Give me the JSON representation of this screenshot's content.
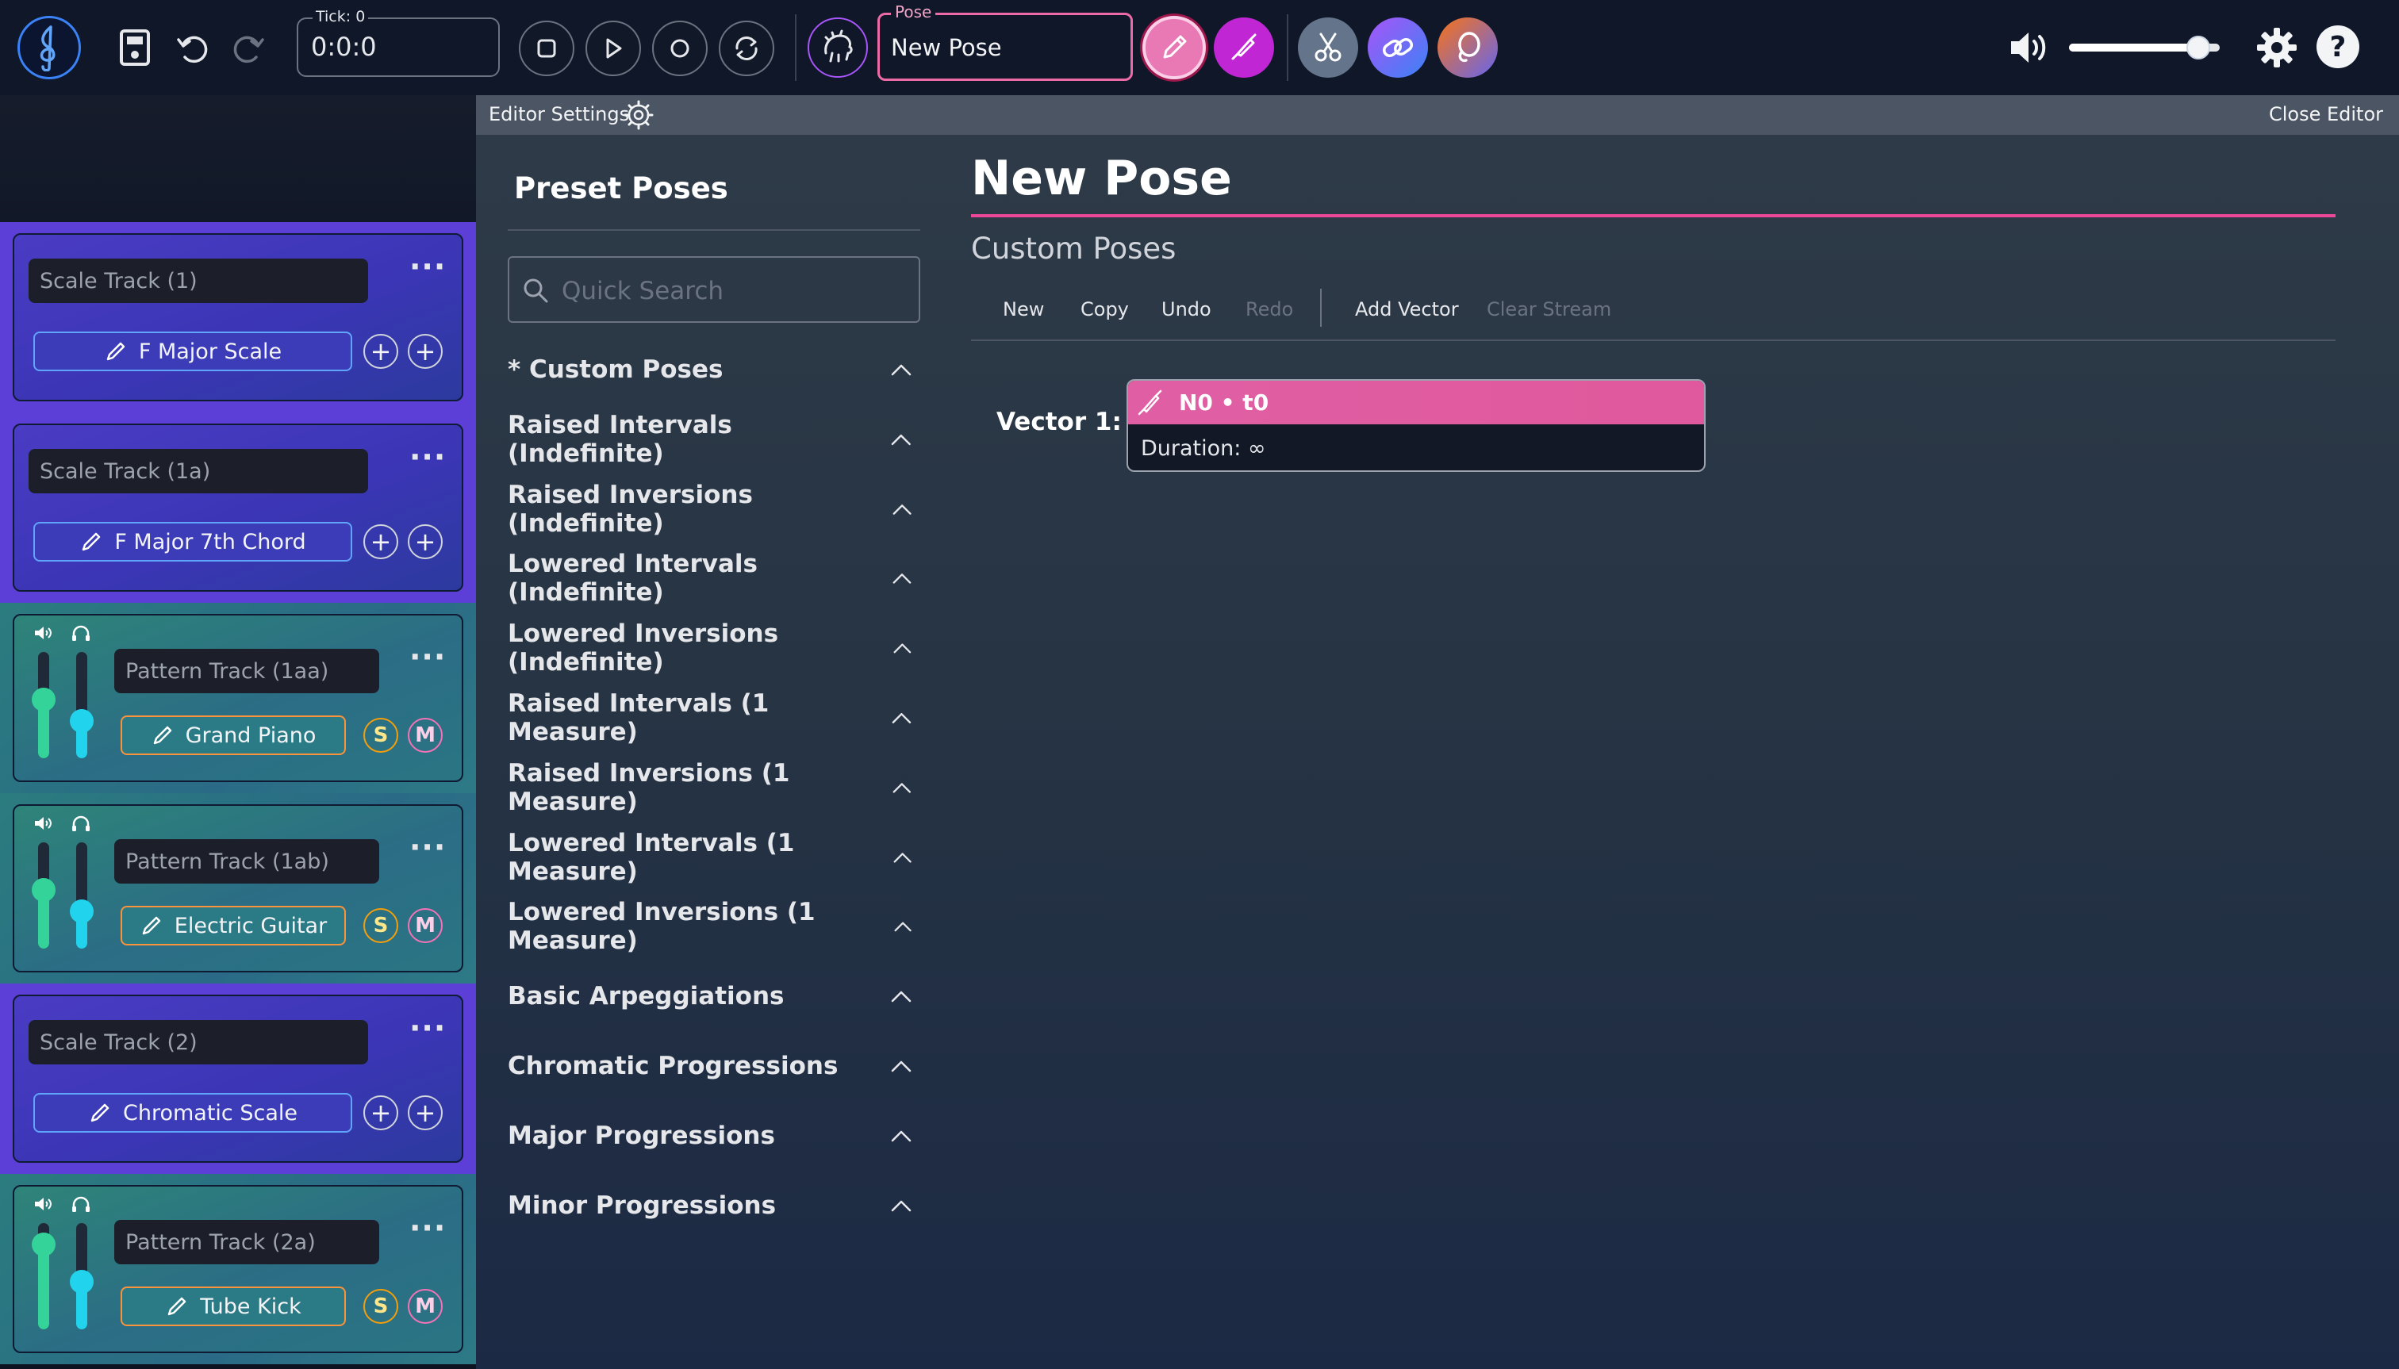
{
  "topbar": {
    "tick_label": "Tick: 0",
    "tick_value": "0:0:0",
    "pose_label": "Pose",
    "pose_value": "New Pose",
    "volume_level": 0.86
  },
  "editor_header": {
    "settings_label": "Editor Settings",
    "close_label": "Close Editor"
  },
  "presets": {
    "title": "Preset Poses",
    "search_placeholder": "Quick Search",
    "categories": [
      "* Custom Poses",
      "Raised Intervals (Indefinite)",
      "Raised Inversions (Indefinite)",
      "Lowered Intervals (Indefinite)",
      "Lowered Inversions (Indefinite)",
      "Raised Intervals (1 Measure)",
      "Raised Inversions (1 Measure)",
      "Lowered Intervals (1 Measure)",
      "Lowered Inversions (1 Measure)",
      "Basic Arpeggiations",
      "Chromatic Progressions",
      "Major Progressions",
      "Minor Progressions"
    ]
  },
  "pose_editor": {
    "title": "New Pose",
    "subtitle": "Custom Poses",
    "toolbar": {
      "new": "New",
      "copy": "Copy",
      "undo": "Undo",
      "redo": "Redo",
      "add_vector": "Add Vector",
      "clear_stream": "Clear Stream"
    },
    "vector": {
      "label": "Vector 1:",
      "name": "N0 • t0",
      "duration": "Duration: ∞"
    }
  },
  "tracks": [
    {
      "type": "scale",
      "name": "Scale Track (1)",
      "instrument": "F Major Scale"
    },
    {
      "type": "scale",
      "name": "Scale Track (1a)",
      "instrument": "F Major 7th Chord"
    },
    {
      "type": "pattern",
      "name": "Pattern Track (1aa)",
      "instrument": "Grand Piano",
      "solo": "S",
      "mute": "M",
      "volume": 0.55,
      "pan": 0.35
    },
    {
      "type": "pattern",
      "name": "Pattern Track (1ab)",
      "instrument": "Electric Guitar",
      "solo": "S",
      "mute": "M",
      "volume": 0.55,
      "pan": 0.35
    },
    {
      "type": "scale",
      "name": "Scale Track (2)",
      "instrument": "Chromatic Scale"
    },
    {
      "type": "pattern",
      "name": "Pattern Track (2a)",
      "instrument": "Tube Kick",
      "solo": "S",
      "mute": "M",
      "volume": 0.8,
      "pan": 0.45
    }
  ],
  "colors": {
    "accent_pink": "#ec4899",
    "accent_purple": "#a855f7",
    "scale_track": "#5b3fd6",
    "pattern_track": "#2b7c7f"
  }
}
